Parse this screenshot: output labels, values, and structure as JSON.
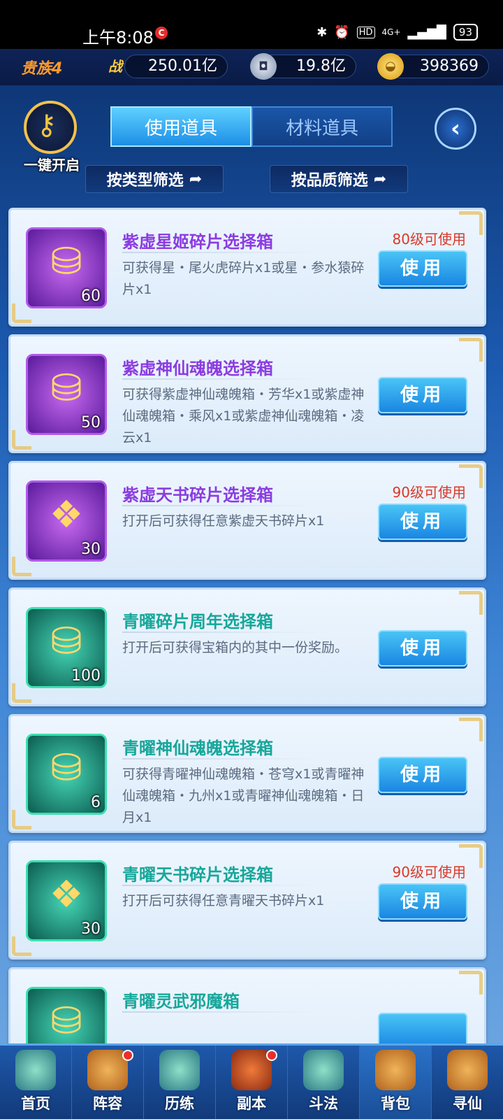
{
  "status_bar": {
    "time": "上午8:08",
    "rec_badge": "C",
    "network": "4G+",
    "battery": "93"
  },
  "resources": {
    "noble": "贵族4",
    "combat_icon": "战",
    "combat_power": "250.01亿",
    "silver": "19.8亿",
    "gold": "398369"
  },
  "header": {
    "one_key_open": "一键开启",
    "tabs": [
      {
        "label": "使用道具",
        "active": true
      },
      {
        "label": "材料道具",
        "active": false
      }
    ],
    "back_icon": "back-arrow-icon",
    "filters": [
      "按类型筛选",
      "按品质筛选"
    ]
  },
  "items": [
    {
      "name": "紫虚星姬碎片选择箱",
      "quality": "purple",
      "count": "60",
      "level_req": "80级可使用",
      "desc": "可获得星・尾火虎碎片x1或星・参水猿碎片x1",
      "button": "使用"
    },
    {
      "name": "紫虚神仙魂魄选择箱",
      "quality": "purple",
      "count": "50",
      "level_req": "",
      "desc": "可获得紫虚神仙魂魄箱・芳华x1或紫虚神仙魂魄箱・乘风x1或紫虚神仙魂魄箱・凌云x1",
      "button": "使用"
    },
    {
      "name": "紫虚天书碎片选择箱",
      "quality": "purple",
      "count": "30",
      "level_req": "90级可使用",
      "desc": "打开后可获得任意紫虚天书碎片x1",
      "button": "使用"
    },
    {
      "name": "青曜碎片周年选择箱",
      "quality": "green",
      "count": "100",
      "level_req": "",
      "desc": "打开后可获得宝箱内的其中一份奖励。",
      "button": "使用"
    },
    {
      "name": "青曜神仙魂魄选择箱",
      "quality": "green",
      "count": "6",
      "level_req": "",
      "desc": "可获得青曜神仙魂魄箱・苍穹x1或青曜神仙魂魄箱・九州x1或青曜神仙魂魄箱・日月x1",
      "button": "使用"
    },
    {
      "name": "青曜天书碎片选择箱",
      "quality": "green",
      "count": "30",
      "level_req": "90级可使用",
      "desc": "打开后可获得任意青曜天书碎片x1",
      "button": "使用"
    },
    {
      "name": "青曜灵武邪魔箱",
      "quality": "green",
      "count": "",
      "level_req": "",
      "desc": "",
      "button": ""
    }
  ],
  "nav": [
    {
      "label": "首页",
      "dot": false
    },
    {
      "label": "阵容",
      "dot": true
    },
    {
      "label": "历练",
      "dot": false
    },
    {
      "label": "副本",
      "dot": true
    },
    {
      "label": "斗法",
      "dot": false
    },
    {
      "label": "背包",
      "dot": false
    },
    {
      "label": "寻仙",
      "dot": false
    }
  ]
}
